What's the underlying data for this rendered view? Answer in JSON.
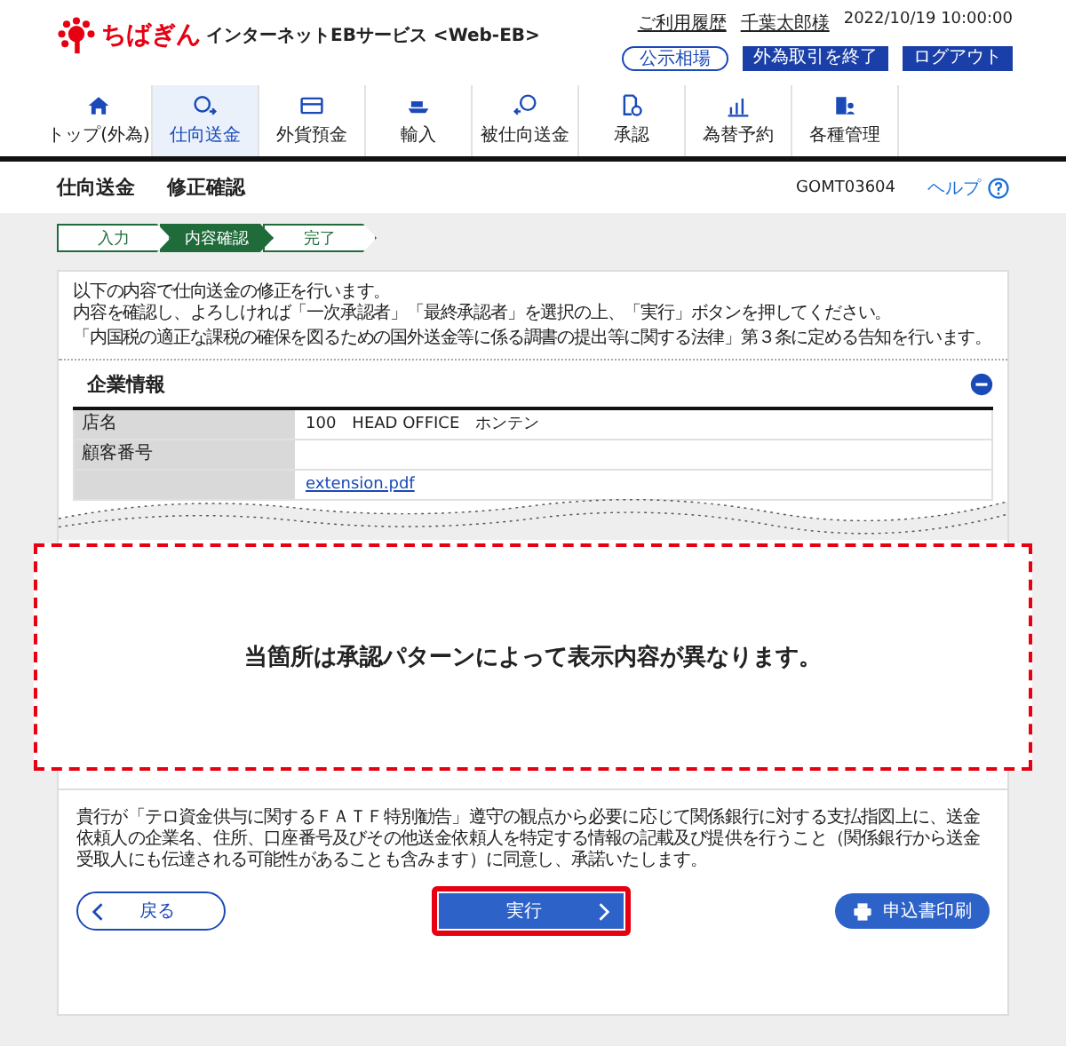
{
  "header": {
    "brand": "ちばぎん",
    "service": "インターネットEBサービス <Web-EB>",
    "history_link": "ご利用履歴",
    "user_link": "千葉太郎様",
    "datetime": "2022/10/19 10:00:00",
    "buttons": [
      {
        "label": "公示相場",
        "kind": "outline"
      },
      {
        "label": "外為取引を終了",
        "kind": "solid"
      },
      {
        "label": "ログアウト",
        "kind": "solid"
      }
    ]
  },
  "nav": [
    {
      "label": "トップ(外為)",
      "selected": false
    },
    {
      "label": "仕向送金",
      "selected": true
    },
    {
      "label": "外貨預金",
      "selected": false
    },
    {
      "label": "輸入",
      "selected": false
    },
    {
      "label": "被仕向送金",
      "selected": false
    },
    {
      "label": "承認",
      "selected": false
    },
    {
      "label": "為替予約",
      "selected": false
    },
    {
      "label": "各種管理",
      "selected": false
    }
  ],
  "page": {
    "title": "仕向送金",
    "subtitle": "修正確認",
    "screen_id": "GOMT03604",
    "help": "ヘルプ"
  },
  "steps": [
    {
      "label": "入力",
      "selected": false
    },
    {
      "label": "内容確認",
      "selected": true
    },
    {
      "label": "完了",
      "selected": false
    }
  ],
  "intro": [
    "以下の内容で仕向送金の修正を行います。",
    "内容を確認し、よろしければ「一次承認者」「最終承認者」を選択の上、「実行」ボタンを押してください。",
    "「内国税の適正な課税の確保を図るための国外送金等に係る調書の提出等に関する法律」第３条に定める告知を行います。"
  ],
  "section": {
    "title": "企業情報",
    "expanded": true,
    "rows": [
      {
        "label": "店名",
        "value": "100　HEAD OFFICE　ホンテン",
        "kind": "text"
      },
      {
        "label": "顧客番号",
        "kind": "text"
      },
      {
        "value": "extension.pdf",
        "kind": "link"
      }
    ]
  },
  "note": "当箇所は承認パターンによって表示内容が異なります。",
  "consent": "貴行が「テロ資金供与に関するＦＡＴＦ特別勧告」遵守の観点から必要に応じて関係銀行に対する支払指図上に、送金依頼人の企業名、住所、口座番号及びその他送金依頼人を特定する情報の記載及び提供を行うこと（関係銀行から送金受取人にも伝達される可能性があることも含みます）に同意し、承諾いたします。",
  "actions": {
    "back": "戻る",
    "execute": "実行",
    "print": "申込書印刷"
  }
}
